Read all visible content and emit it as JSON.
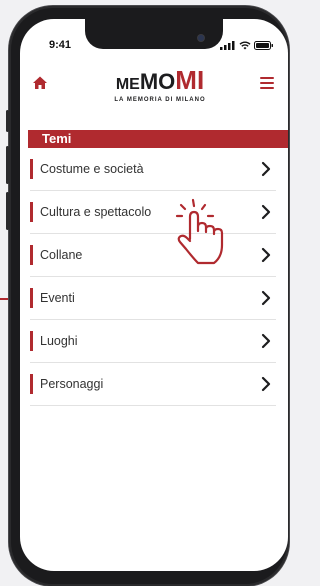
{
  "status": {
    "time": "9:41"
  },
  "logo": {
    "me": "ME",
    "mo": "MO",
    "mi": "MI",
    "subtitle": "LA MEMORIA DI MILANO"
  },
  "section": {
    "title": "Temi"
  },
  "items": [
    {
      "label": "Costume e società"
    },
    {
      "label": "Cultura e spettacolo"
    },
    {
      "label": "Collane"
    },
    {
      "label": "Eventi"
    },
    {
      "label": "Luoghi"
    },
    {
      "label": "Personaggi"
    }
  ],
  "colors": {
    "accent": "#b02a2f",
    "text": "#333333",
    "frame": "#1b1b1d"
  },
  "icons": {
    "home": "home-icon",
    "menu": "hamburger-menu-icon",
    "chevron": "chevron-right-icon",
    "gesture": "tap-hand-icon"
  }
}
